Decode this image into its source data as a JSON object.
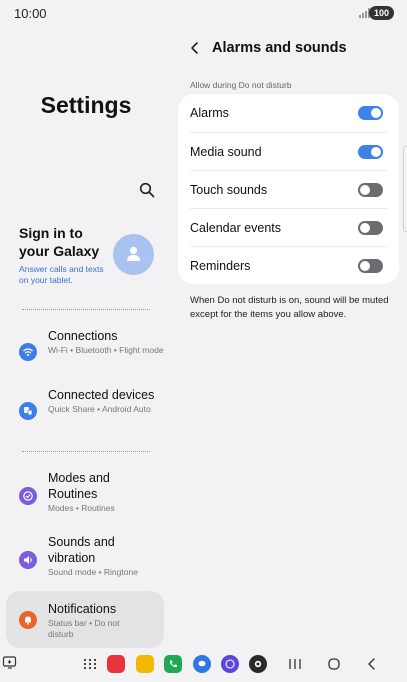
{
  "status_bar": {
    "time": "10:00",
    "battery": "100"
  },
  "left_pane": {
    "title": "Settings",
    "account": {
      "title": "Sign in to your Galaxy",
      "subtitle": "Answer calls and texts on your tablet."
    },
    "menu": [
      {
        "title": "Connections",
        "subtitle": "Wi-Fi • Bluetooth • Flight mode",
        "icon": "wifi-icon",
        "color": "#3f7ee8"
      },
      {
        "title": "Connected devices",
        "subtitle": "Quick Share • Android Auto",
        "icon": "connected-devices-icon",
        "color": "#3f7ee8"
      },
      {
        "title": "Modes and Routines",
        "subtitle": "Modes • Routines",
        "icon": "modes-icon",
        "color": "#7b5be0"
      },
      {
        "title": "Sounds and vibration",
        "subtitle": "Sound mode • Ringtone",
        "icon": "sound-icon",
        "color": "#7b5be0"
      },
      {
        "title": "Notifications",
        "subtitle": "Status bar • Do not disturb",
        "icon": "bell-icon",
        "color": "#e8662d"
      }
    ]
  },
  "right_pane": {
    "title": "Alarms and sounds",
    "section_label": "Allow during Do not disturb",
    "rows": [
      {
        "label": "Alarms",
        "on": true
      },
      {
        "label": "Media sound",
        "on": true
      },
      {
        "label": "Touch sounds",
        "on": false
      },
      {
        "label": "Calendar events",
        "on": false
      },
      {
        "label": "Reminders",
        "on": false
      }
    ],
    "note": "When Do not disturb is on, sound will be muted except for the items you allow above."
  },
  "nav_bar": {
    "apps": [
      {
        "name": "flipboard-app-icon",
        "color": "#e8333a"
      },
      {
        "name": "notes-app-icon",
        "color": "#f5b800"
      },
      {
        "name": "phone-app-icon",
        "color": "#1fa955"
      },
      {
        "name": "messages-app-icon",
        "color": "#2f78e0"
      },
      {
        "name": "internet-app-icon",
        "color": "#5b48d8"
      },
      {
        "name": "camera-app-icon",
        "color": "#2a2a2a"
      }
    ]
  }
}
